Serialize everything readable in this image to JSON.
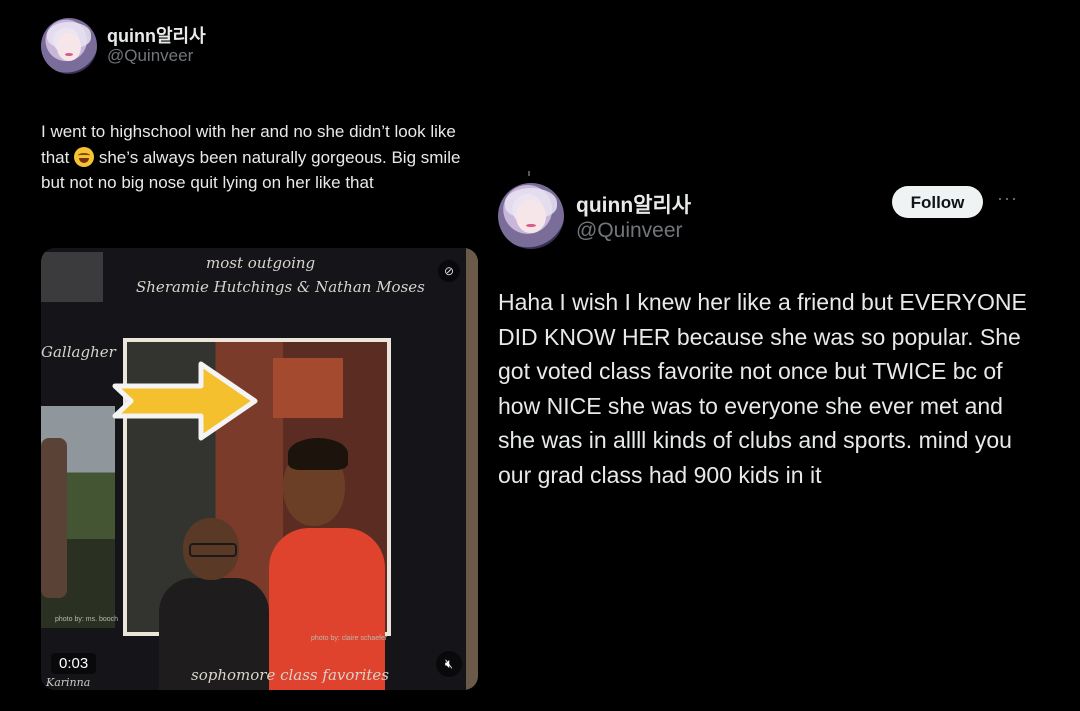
{
  "tweet1": {
    "display_name": "quinn알리사",
    "handle": "@Quinveer",
    "text_before_emoji": "I went to highschool with her and no she didn’t look like that",
    "emoji": "laughing-face",
    "text_after_emoji": "she’s always been naturally gorgeous. Big smile but not no big nose quit lying on her like that",
    "media": {
      "caption_top_1": "most outgoing",
      "caption_top_2": "Sheramie Hutchings & Nathan Moses",
      "caption_left": "Gallagher",
      "caption_bottom": "sophomore class favorites",
      "credit_left": "photo by: ms. booch",
      "credit_right": "photo by: claire schaefer",
      "corner_word": "Karinna",
      "duration": "0:03",
      "mute_icon": "speaker-muted-icon",
      "sensitive_icon": "content-warning-icon"
    }
  },
  "tweet2": {
    "display_name": "quinn알리사",
    "handle": "@Quinveer",
    "follow_label": "Follow",
    "more_label": "···",
    "text": "Haha I wish I knew her like a friend but EVERYONE DID KNOW HER because she was so popular. She got voted class favorite not once but TWICE bc of how NICE she was to everyone she ever met and she was in allll kinds of clubs and sports. mind you our grad class had 900 kids in it"
  },
  "colors": {
    "background": "#000000",
    "text": "#e7e9ea",
    "secondary": "#71767b",
    "follow_bg": "#eff3f4",
    "arrow": "#f5c02e"
  }
}
